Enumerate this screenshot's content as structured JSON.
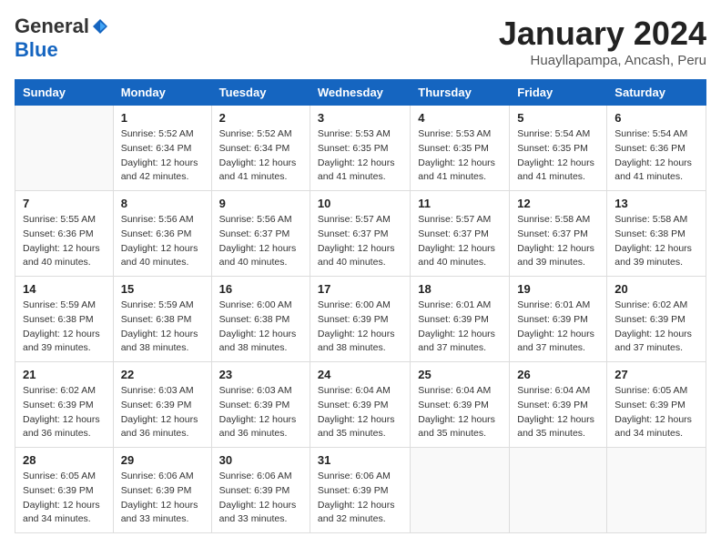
{
  "header": {
    "logo_general": "General",
    "logo_blue": "Blue",
    "month_title": "January 2024",
    "location": "Huayllapampa, Ancash, Peru"
  },
  "calendar": {
    "headers": [
      "Sunday",
      "Monday",
      "Tuesday",
      "Wednesday",
      "Thursday",
      "Friday",
      "Saturday"
    ],
    "weeks": [
      [
        {
          "day": "",
          "sunrise": "",
          "sunset": "",
          "daylight": ""
        },
        {
          "day": "1",
          "sunrise": "Sunrise: 5:52 AM",
          "sunset": "Sunset: 6:34 PM",
          "daylight": "Daylight: 12 hours and 42 minutes."
        },
        {
          "day": "2",
          "sunrise": "Sunrise: 5:52 AM",
          "sunset": "Sunset: 6:34 PM",
          "daylight": "Daylight: 12 hours and 41 minutes."
        },
        {
          "day": "3",
          "sunrise": "Sunrise: 5:53 AM",
          "sunset": "Sunset: 6:35 PM",
          "daylight": "Daylight: 12 hours and 41 minutes."
        },
        {
          "day": "4",
          "sunrise": "Sunrise: 5:53 AM",
          "sunset": "Sunset: 6:35 PM",
          "daylight": "Daylight: 12 hours and 41 minutes."
        },
        {
          "day": "5",
          "sunrise": "Sunrise: 5:54 AM",
          "sunset": "Sunset: 6:35 PM",
          "daylight": "Daylight: 12 hours and 41 minutes."
        },
        {
          "day": "6",
          "sunrise": "Sunrise: 5:54 AM",
          "sunset": "Sunset: 6:36 PM",
          "daylight": "Daylight: 12 hours and 41 minutes."
        }
      ],
      [
        {
          "day": "7",
          "sunrise": "Sunrise: 5:55 AM",
          "sunset": "Sunset: 6:36 PM",
          "daylight": "Daylight: 12 hours and 40 minutes."
        },
        {
          "day": "8",
          "sunrise": "Sunrise: 5:56 AM",
          "sunset": "Sunset: 6:36 PM",
          "daylight": "Daylight: 12 hours and 40 minutes."
        },
        {
          "day": "9",
          "sunrise": "Sunrise: 5:56 AM",
          "sunset": "Sunset: 6:37 PM",
          "daylight": "Daylight: 12 hours and 40 minutes."
        },
        {
          "day": "10",
          "sunrise": "Sunrise: 5:57 AM",
          "sunset": "Sunset: 6:37 PM",
          "daylight": "Daylight: 12 hours and 40 minutes."
        },
        {
          "day": "11",
          "sunrise": "Sunrise: 5:57 AM",
          "sunset": "Sunset: 6:37 PM",
          "daylight": "Daylight: 12 hours and 40 minutes."
        },
        {
          "day": "12",
          "sunrise": "Sunrise: 5:58 AM",
          "sunset": "Sunset: 6:37 PM",
          "daylight": "Daylight: 12 hours and 39 minutes."
        },
        {
          "day": "13",
          "sunrise": "Sunrise: 5:58 AM",
          "sunset": "Sunset: 6:38 PM",
          "daylight": "Daylight: 12 hours and 39 minutes."
        }
      ],
      [
        {
          "day": "14",
          "sunrise": "Sunrise: 5:59 AM",
          "sunset": "Sunset: 6:38 PM",
          "daylight": "Daylight: 12 hours and 39 minutes."
        },
        {
          "day": "15",
          "sunrise": "Sunrise: 5:59 AM",
          "sunset": "Sunset: 6:38 PM",
          "daylight": "Daylight: 12 hours and 38 minutes."
        },
        {
          "day": "16",
          "sunrise": "Sunrise: 6:00 AM",
          "sunset": "Sunset: 6:38 PM",
          "daylight": "Daylight: 12 hours and 38 minutes."
        },
        {
          "day": "17",
          "sunrise": "Sunrise: 6:00 AM",
          "sunset": "Sunset: 6:39 PM",
          "daylight": "Daylight: 12 hours and 38 minutes."
        },
        {
          "day": "18",
          "sunrise": "Sunrise: 6:01 AM",
          "sunset": "Sunset: 6:39 PM",
          "daylight": "Daylight: 12 hours and 37 minutes."
        },
        {
          "day": "19",
          "sunrise": "Sunrise: 6:01 AM",
          "sunset": "Sunset: 6:39 PM",
          "daylight": "Daylight: 12 hours and 37 minutes."
        },
        {
          "day": "20",
          "sunrise": "Sunrise: 6:02 AM",
          "sunset": "Sunset: 6:39 PM",
          "daylight": "Daylight: 12 hours and 37 minutes."
        }
      ],
      [
        {
          "day": "21",
          "sunrise": "Sunrise: 6:02 AM",
          "sunset": "Sunset: 6:39 PM",
          "daylight": "Daylight: 12 hours and 36 minutes."
        },
        {
          "day": "22",
          "sunrise": "Sunrise: 6:03 AM",
          "sunset": "Sunset: 6:39 PM",
          "daylight": "Daylight: 12 hours and 36 minutes."
        },
        {
          "day": "23",
          "sunrise": "Sunrise: 6:03 AM",
          "sunset": "Sunset: 6:39 PM",
          "daylight": "Daylight: 12 hours and 36 minutes."
        },
        {
          "day": "24",
          "sunrise": "Sunrise: 6:04 AM",
          "sunset": "Sunset: 6:39 PM",
          "daylight": "Daylight: 12 hours and 35 minutes."
        },
        {
          "day": "25",
          "sunrise": "Sunrise: 6:04 AM",
          "sunset": "Sunset: 6:39 PM",
          "daylight": "Daylight: 12 hours and 35 minutes."
        },
        {
          "day": "26",
          "sunrise": "Sunrise: 6:04 AM",
          "sunset": "Sunset: 6:39 PM",
          "daylight": "Daylight: 12 hours and 35 minutes."
        },
        {
          "day": "27",
          "sunrise": "Sunrise: 6:05 AM",
          "sunset": "Sunset: 6:39 PM",
          "daylight": "Daylight: 12 hours and 34 minutes."
        }
      ],
      [
        {
          "day": "28",
          "sunrise": "Sunrise: 6:05 AM",
          "sunset": "Sunset: 6:39 PM",
          "daylight": "Daylight: 12 hours and 34 minutes."
        },
        {
          "day": "29",
          "sunrise": "Sunrise: 6:06 AM",
          "sunset": "Sunset: 6:39 PM",
          "daylight": "Daylight: 12 hours and 33 minutes."
        },
        {
          "day": "30",
          "sunrise": "Sunrise: 6:06 AM",
          "sunset": "Sunset: 6:39 PM",
          "daylight": "Daylight: 12 hours and 33 minutes."
        },
        {
          "day": "31",
          "sunrise": "Sunrise: 6:06 AM",
          "sunset": "Sunset: 6:39 PM",
          "daylight": "Daylight: 12 hours and 32 minutes."
        },
        {
          "day": "",
          "sunrise": "",
          "sunset": "",
          "daylight": ""
        },
        {
          "day": "",
          "sunrise": "",
          "sunset": "",
          "daylight": ""
        },
        {
          "day": "",
          "sunrise": "",
          "sunset": "",
          "daylight": ""
        }
      ]
    ]
  }
}
